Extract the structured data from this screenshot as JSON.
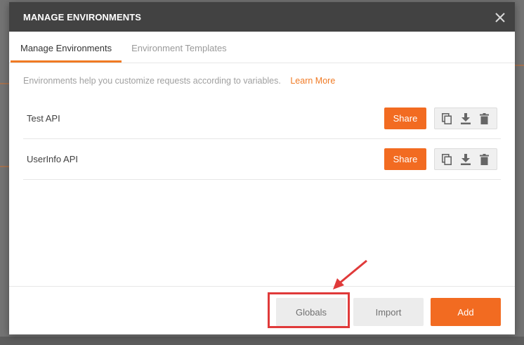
{
  "modal": {
    "title": "MANAGE ENVIRONMENTS",
    "close_icon": "close-icon"
  },
  "tabs": [
    {
      "label": "Manage Environments",
      "active": true
    },
    {
      "label": "Environment Templates",
      "active": false
    }
  ],
  "info": {
    "text": "Environments help you customize requests according to variables.",
    "link": "Learn More"
  },
  "environments": [
    {
      "name": "Test API",
      "share_label": "Share"
    },
    {
      "name": "UserInfo API",
      "share_label": "Share"
    }
  ],
  "row_icons": [
    "duplicate-icon",
    "download-icon",
    "trash-icon"
  ],
  "footer": {
    "globals_label": "Globals",
    "import_label": "Import",
    "add_label": "Add"
  },
  "colors": {
    "accent": "#f26b21",
    "header": "#424242",
    "annotation": "#e03a3a"
  }
}
